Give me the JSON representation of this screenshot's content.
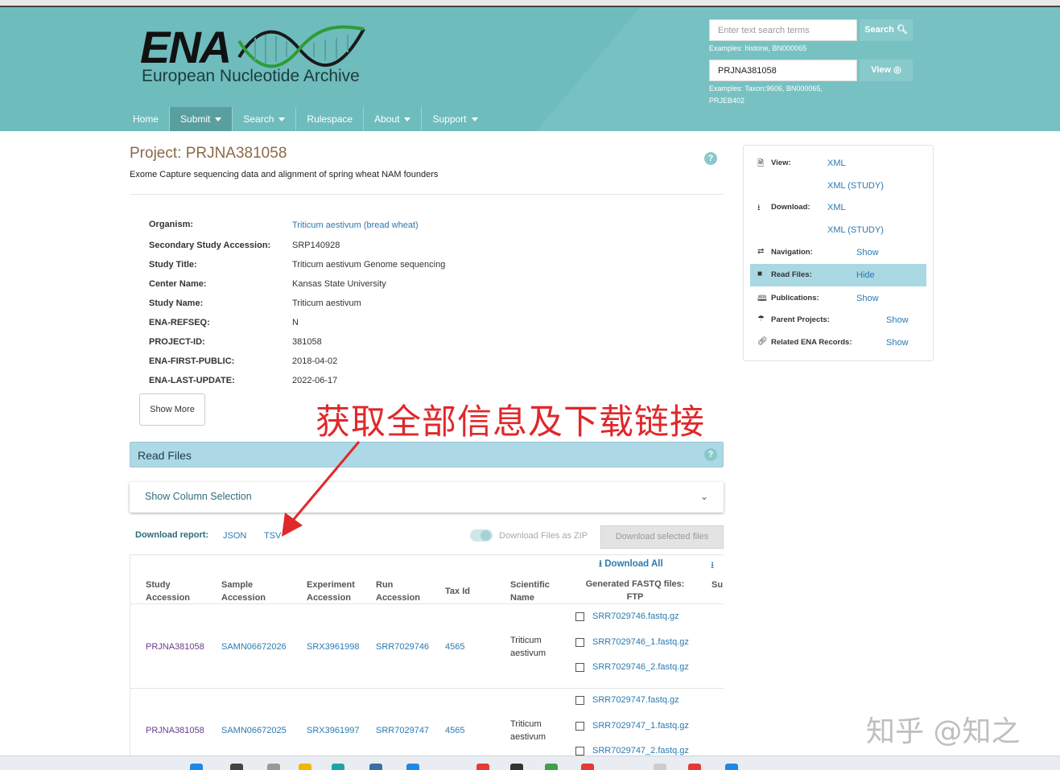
{
  "header": {
    "logo_text": "ENA",
    "logo_subtitle": "European Nucleotide Archive",
    "search_placeholder": "Enter text search terms",
    "search_button": "Search",
    "search_examples": "Examples: histone, BN000065",
    "view_value": "PRJNA381058",
    "view_button": "View",
    "view_examples": "Examples: Taxon:9606, BN000065, PRJEB402"
  },
  "nav": {
    "items": [
      {
        "label": "Home"
      },
      {
        "label": "Submit"
      },
      {
        "label": "Search"
      },
      {
        "label": "Rulespace"
      },
      {
        "label": "About"
      },
      {
        "label": "Support"
      }
    ]
  },
  "project": {
    "title": "Project: PRJNA381058",
    "description": "Exome Capture sequencing data and alignment of spring wheat NAM founders",
    "help": "?",
    "fields": [
      {
        "label": "Organism:",
        "value": "Triticum aestivum (bread wheat)"
      },
      {
        "label": "Secondary Study Accession:",
        "value": "SRP140928"
      },
      {
        "label": "Study Title:",
        "value": "Triticum aestivum Genome sequencing"
      },
      {
        "label": "Center Name:",
        "value": "Kansas State University"
      },
      {
        "label": "Study Name:",
        "value": "Triticum aestivum"
      },
      {
        "label": "ENA-REFSEQ:",
        "value": "N"
      },
      {
        "label": "PROJECT-ID:",
        "value": "381058"
      },
      {
        "label": "ENA-FIRST-PUBLIC:",
        "value": "2018-04-02"
      },
      {
        "label": "ENA-LAST-UPDATE:",
        "value": "2022-06-17"
      }
    ],
    "show_more": "Show More"
  },
  "sidebar": {
    "view_label": "View:",
    "view_xml": "XML",
    "view_xml_study": "XML (STUDY)",
    "download_label": "Download:",
    "download_xml": "XML",
    "download_xml_study": "XML (STUDY)",
    "navigation_label": "Navigation:",
    "navigation_link": "Show",
    "readfiles_label": "Read Files:",
    "readfiles_link": "Hide",
    "publications_label": "Publications:",
    "publications_link": "Show",
    "parent_label": "Parent Projects:",
    "parent_link": "Show",
    "related_label": "Related ENA Records:",
    "related_link": "Show"
  },
  "read_files": {
    "title": "Read Files",
    "help": "?",
    "column_selection": "Show Column Selection",
    "download_report_label": "Download report:",
    "json_link": "JSON",
    "tsv_link": "TSV",
    "zip_toggle_label": "Download Files as ZIP",
    "download_selected": "Download selected files",
    "download_all": "Download All",
    "columns": {
      "study": "Study Accession",
      "sample": "Sample Accession",
      "experiment": "Experiment Accession",
      "run": "Run Accession",
      "taxid": "Tax Id",
      "sciname": "Scientific Name",
      "fastq": "Generated FASTQ files: FTP",
      "submitted": "Su"
    },
    "rows": [
      {
        "study": "PRJNA381058",
        "sample": "SAMN06672026",
        "experiment": "SRX3961998",
        "run": "SRR7029746",
        "taxid": "4565",
        "sciname": "Triticum aestivum",
        "files": [
          "SRR7029746.fastq.gz",
          "SRR7029746_1.fastq.gz",
          "SRR7029746_2.fastq.gz"
        ]
      },
      {
        "study": "PRJNA381058",
        "sample": "SAMN06672025",
        "experiment": "SRX3961997",
        "run": "SRR7029747",
        "taxid": "4565",
        "sciname": "Triticum aestivum",
        "files": [
          "SRR7029747.fastq.gz",
          "SRR7029747_1.fastq.gz",
          "SRR7029747_2.fastq.gz"
        ]
      }
    ]
  },
  "annotation": {
    "text": "获取全部信息及下载链接",
    "color": "#e0282b"
  },
  "watermark": "知乎 @知之",
  "colors": {
    "header_bg": "#6fbcbd",
    "link": "#2a7ab0",
    "title": "#8a6a46",
    "readbar": "#add8e6"
  }
}
